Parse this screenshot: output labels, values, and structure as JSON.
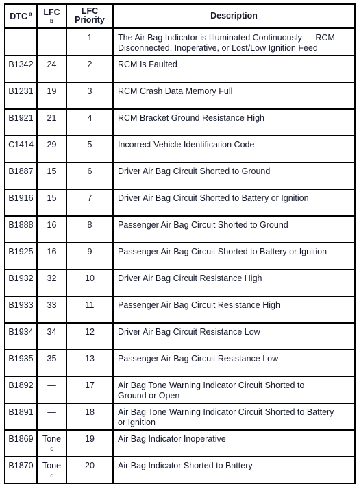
{
  "table": {
    "name": "Air Bag / RCM DTC and LFC Priority Table",
    "columns": [
      {
        "key": "dtc",
        "label": "DTC",
        "superscript": "a",
        "sup_position": "inline"
      },
      {
        "key": "lfc",
        "label": "LFC",
        "superscript": "b",
        "sup_position": "below"
      },
      {
        "key": "priority",
        "label_line1": "LFC",
        "label_line2": "Priority",
        "superscript": "",
        "sup_position": "none"
      },
      {
        "key": "desc",
        "label": "Description",
        "superscript": "",
        "sup_position": "none"
      }
    ],
    "rows": [
      {
        "dtc": "—",
        "lfc": "—",
        "lfc_sup": "",
        "priority": "1",
        "desc_lines": [
          "The Air Bag Indicator is Illuminated Continuously — RCM",
          "Disconnected, Inoperative, or Lost/Low Ignition Feed"
        ]
      },
      {
        "dtc": "B1342",
        "lfc": "24",
        "lfc_sup": "",
        "priority": "2",
        "desc_lines": [
          "RCM Is Faulted"
        ]
      },
      {
        "dtc": "B1231",
        "lfc": "19",
        "lfc_sup": "",
        "priority": "3",
        "desc_lines": [
          "RCM Crash Data Memory Full"
        ]
      },
      {
        "dtc": "B1921",
        "lfc": "21",
        "lfc_sup": "",
        "priority": "4",
        "desc_lines": [
          "RCM Bracket Ground Resistance High"
        ]
      },
      {
        "dtc": "C1414",
        "lfc": "29",
        "lfc_sup": "",
        "priority": "5",
        "desc_lines": [
          "Incorrect Vehicle Identification Code"
        ]
      },
      {
        "dtc": "B1887",
        "lfc": "15",
        "lfc_sup": "",
        "priority": "6",
        "desc_lines": [
          "Driver Air Bag Circuit Shorted to Ground"
        ]
      },
      {
        "dtc": "B1916",
        "lfc": "15",
        "lfc_sup": "",
        "priority": "7",
        "desc_lines": [
          "Driver Air Bag Circuit Shorted to Battery or Ignition"
        ]
      },
      {
        "dtc": "B1888",
        "lfc": "16",
        "lfc_sup": "",
        "priority": "8",
        "desc_lines": [
          "Passenger Air Bag Circuit Shorted to Ground"
        ]
      },
      {
        "dtc": "B1925",
        "lfc": "16",
        "lfc_sup": "",
        "priority": "9",
        "desc_lines": [
          "Passenger Air Bag Circuit Shorted to Battery or Ignition"
        ]
      },
      {
        "dtc": "B1932",
        "lfc": "32",
        "lfc_sup": "",
        "priority": "10",
        "desc_lines": [
          "Driver Air Bag Circuit Resistance High"
        ]
      },
      {
        "dtc": "B1933",
        "lfc": "33",
        "lfc_sup": "",
        "priority": "11",
        "desc_lines": [
          "Passenger Air Bag Circuit Resistance High"
        ]
      },
      {
        "dtc": "B1934",
        "lfc": "34",
        "lfc_sup": "",
        "priority": "12",
        "desc_lines": [
          "Driver Air Bag Circuit Resistance Low"
        ]
      },
      {
        "dtc": "B1935",
        "lfc": "35",
        "lfc_sup": "",
        "priority": "13",
        "desc_lines": [
          "Passenger Air Bag Circuit Resistance Low"
        ]
      },
      {
        "dtc": "B1892",
        "lfc": "—",
        "lfc_sup": "",
        "priority": "17",
        "desc_lines": [
          "Air Bag Tone Warning Indicator Circuit Shorted to",
          "Ground or Open"
        ]
      },
      {
        "dtc": "B1891",
        "lfc": "—",
        "lfc_sup": "",
        "priority": "18",
        "desc_lines": [
          "Air Bag Tone Warning Indicator Circuit Shorted to Battery",
          "or Ignition"
        ]
      },
      {
        "dtc": "B1869",
        "lfc": "Tone",
        "lfc_sup": "c",
        "priority": "19",
        "desc_lines": [
          "Air Bag Indicator Inoperative"
        ]
      },
      {
        "dtc": "B1870",
        "lfc": "Tone",
        "lfc_sup": "c",
        "priority": "20",
        "desc_lines": [
          "Air Bag Indicator Shorted to Battery"
        ]
      }
    ]
  },
  "colors": {
    "text": "#15192b",
    "border": "#000000",
    "background": "#ffffff"
  }
}
